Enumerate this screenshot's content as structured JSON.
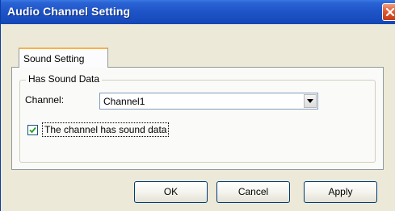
{
  "window": {
    "title": "Audio Channel Setting"
  },
  "tabs": [
    {
      "label": "Sound Setting",
      "active": true
    }
  ],
  "group": {
    "legend": "Has Sound Data",
    "channel_label": "Channel:",
    "channel_select": {
      "value": "Channel1"
    },
    "checkbox": {
      "label": "The channel has sound data",
      "checked": true
    }
  },
  "buttons": {
    "ok": "OK",
    "cancel": "Cancel",
    "apply": "Apply"
  },
  "icons": {
    "close": "close-icon",
    "dropdown": "chevron-down-icon",
    "check": "checkmark-icon"
  },
  "colors": {
    "titlebar": "#1f55c8",
    "close_button": "#e05a30",
    "tab_highlight": "#f7b24a",
    "dialog_bg": "#ece9d8",
    "button_border": "#003c74"
  }
}
